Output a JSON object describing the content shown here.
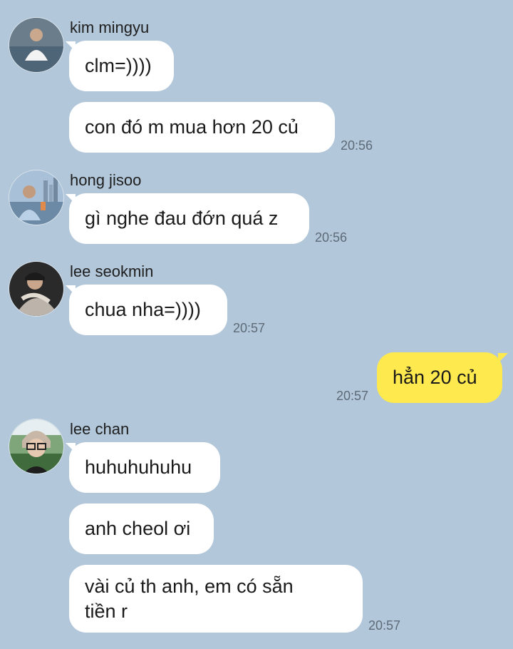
{
  "messages": {
    "g1": {
      "sender": "kim mingyu",
      "avatar": "kim-mingyu-avatar",
      "bubbles": [
        "clm=))))",
        "con đó m mua hơn 20 củ"
      ],
      "time": "20:56"
    },
    "g2": {
      "sender": "hong jisoo",
      "avatar": "hong-jisoo-avatar",
      "bubbles": [
        "gì nghe đau đớn quá z"
      ],
      "time": "20:56"
    },
    "g3": {
      "sender": "lee seokmin",
      "avatar": "lee-seokmin-avatar",
      "bubbles": [
        "chua nha=))))"
      ],
      "time": "20:57"
    },
    "mine": {
      "text": "hẳn 20 củ",
      "time": "20:57"
    },
    "g4": {
      "sender": "lee chan",
      "avatar": "lee-chan-avatar",
      "bubbles": [
        "huhuhuhuhu",
        "anh cheol ơi",
        "vài củ th anh, em có sẵn tiền r"
      ],
      "time": "20:57"
    }
  },
  "colors": {
    "background": "#b2c7d9",
    "incoming_bubble": "#ffffff",
    "outgoing_bubble": "#fee94f",
    "timestamp": "#5d6a78"
  }
}
